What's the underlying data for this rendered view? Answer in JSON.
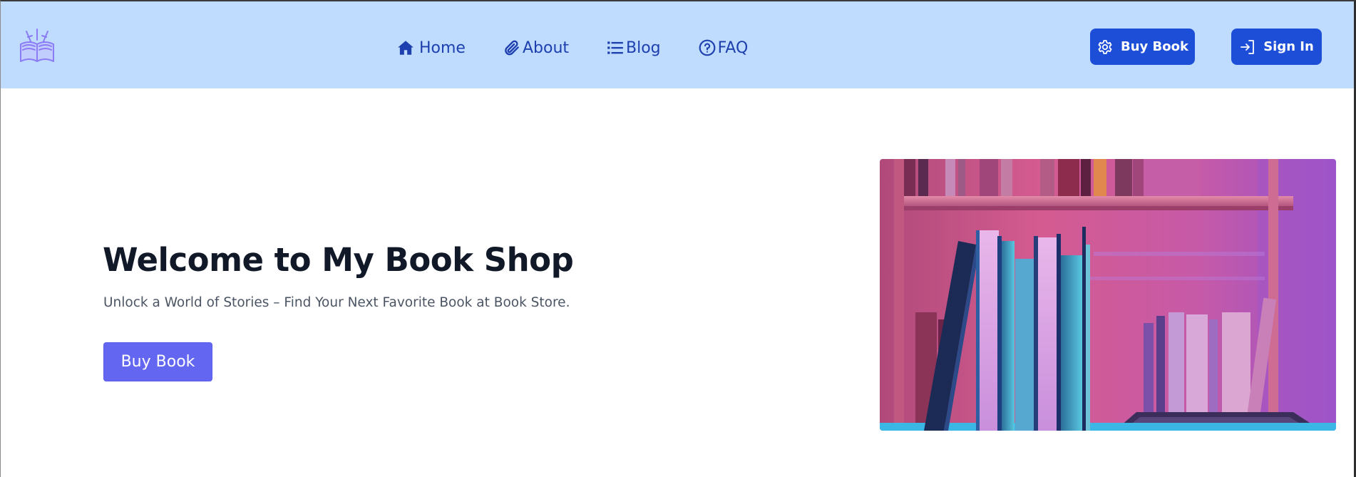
{
  "navbar": {
    "logo_icon": "open-book-logo-icon",
    "links": [
      {
        "label": "Home",
        "icon": "home-icon"
      },
      {
        "label": "About",
        "icon": "paperclip-icon"
      },
      {
        "label": "Blog",
        "icon": "list-icon"
      },
      {
        "label": "FAQ",
        "icon": "question-circle-icon"
      }
    ],
    "buy_button": {
      "label": "Buy Book",
      "icon": "gear-icon"
    },
    "signin_button": {
      "label": "Sign In",
      "icon": "sign-in-icon"
    }
  },
  "hero": {
    "title": "Welcome to My Book Shop",
    "subtitle": "Unlock a World of Stories – Find Your Next Favorite Book at Book Store.",
    "cta_label": "Buy Book",
    "image_icon": "bookshelf-photo"
  },
  "colors": {
    "navbar_bg": "#bfdbfe",
    "nav_text": "#1e40af",
    "nav_button": "#1d4ed8",
    "cta_button": "#6366f1"
  }
}
